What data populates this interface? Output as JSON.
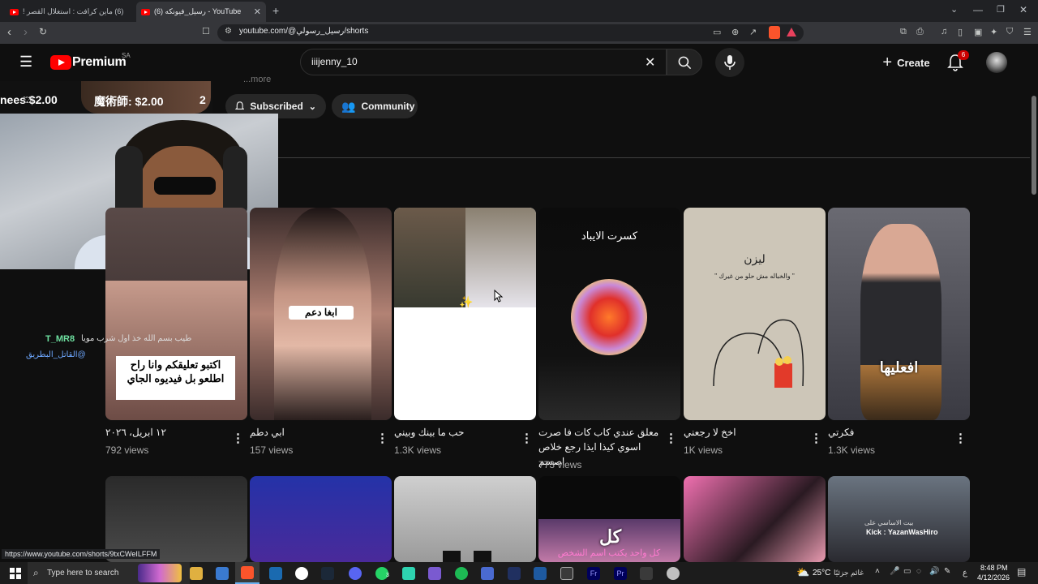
{
  "browser": {
    "tabs": [
      {
        "title": "(6) ماين كرافت : استغلال القصر !"
      },
      {
        "title": "(6) رسيل_فيونكه - YouTube"
      }
    ],
    "new_tab": "+",
    "url": "youtube.com/@رسيل_رسولي/shorts",
    "status_url": "https://www.youtube.com/shorts/9txCWeILFFM"
  },
  "youtube": {
    "brand": "Premium",
    "region": "SA",
    "search": {
      "value": "iiijenny_10"
    },
    "create_label": "Create",
    "notification_count": "6"
  },
  "channel": {
    "subscribed_label": "Subscribed",
    "community_label": "Community",
    "meta_partial": "...more"
  },
  "overlay": {
    "ticker_left": "nees $2.00",
    "ticker_mid": "魔術師: $2.00",
    "ticker_num": "2"
  },
  "shorts_row1": [
    {
      "title": "١٢ ابريل، ٢٠٢٦",
      "views": "792 views",
      "caption": "اكتبو تعليقكم وانا راح اطلعو بل فيديوه الجاي",
      "chat_user": "T_MR8",
      "chat_text": "طيب بسم الله خذ اول شرب مويا",
      "chat_sub": "القاتل_البطريق@"
    },
    {
      "title": "ابي دطم",
      "views": "157 views",
      "caption": "ابغا دعم"
    },
    {
      "title": "حب ما بينك وبيني",
      "views": "1.3K views"
    },
    {
      "title": "معلق عندي كاب كات فا صرت اسوي كيذا ايذا رجع خلاص اصسم",
      "views": "773 views",
      "caption": "كسرت الايباد"
    },
    {
      "title": "اخخ لا رجعني",
      "views": "1K views",
      "caption": "ليزن",
      "sub": "\" والخباله مش حلو من غيرك \""
    },
    {
      "title": "فكرتي",
      "views": "1.3K views",
      "caption": "افعليها"
    }
  ],
  "shorts_row2": [
    {
      "caption": ""
    },
    {
      "caption": ""
    },
    {
      "caption": ""
    },
    {
      "caption": "كل",
      "sub": "كل واحد يكتب اسم الشخص"
    },
    {
      "caption": ""
    },
    {
      "caption": "Kick : YazanWasHiro",
      "sub": "بيت الاساسي على"
    }
  ],
  "taskbar": {
    "search_placeholder": "Type here to search",
    "weather": "25°C",
    "weather_desc": "غائم جزئيًا",
    "time": "8:48 PM",
    "date": "4/12/2026",
    "lang": "ع",
    "whatsapp_badge": "3"
  }
}
